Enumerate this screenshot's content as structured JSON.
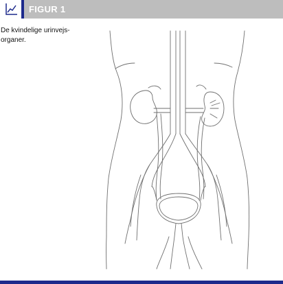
{
  "header": {
    "title": "FIGUR 1",
    "icon": "chart-line-icon",
    "accent_color": "#1d2a8c",
    "bar_color": "#bdbdbd"
  },
  "caption": {
    "line1": "De kvindelige urinvejs-",
    "line2": "organer."
  }
}
